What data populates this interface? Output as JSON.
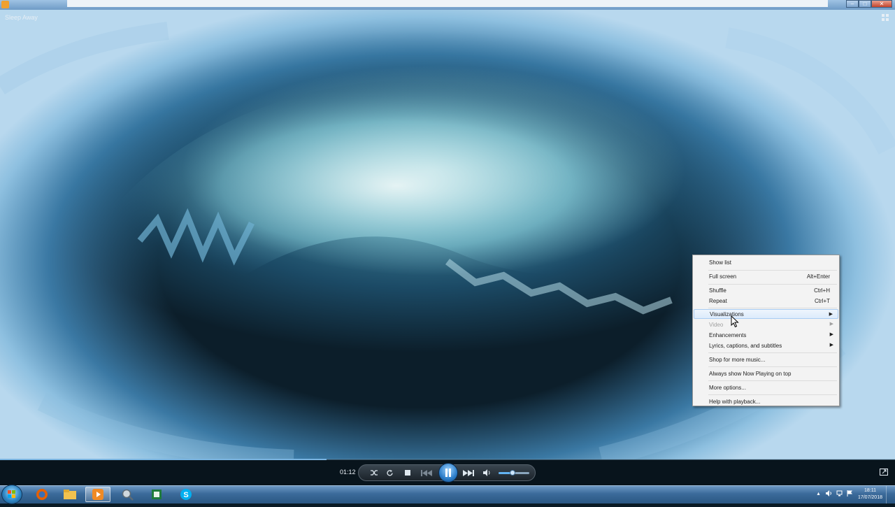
{
  "player": {
    "song_title": "Sleep Away",
    "elapsed": "01:12",
    "progress_fraction": 0.365,
    "volume_fraction": 0.45
  },
  "context_menu": {
    "items": [
      {
        "label": "Show list",
        "shortcut": "",
        "submenu": false,
        "disabled": false
      },
      {
        "label": "Full screen",
        "shortcut": "Alt+Enter",
        "submenu": false,
        "disabled": false
      },
      {
        "label": "Shuffle",
        "shortcut": "Ctrl+H",
        "submenu": false,
        "disabled": false
      },
      {
        "label": "Repeat",
        "shortcut": "Ctrl+T",
        "submenu": false,
        "disabled": false
      },
      {
        "label": "Visualizations",
        "shortcut": "",
        "submenu": true,
        "disabled": false,
        "highlighted": true
      },
      {
        "label": "Video",
        "shortcut": "",
        "submenu": true,
        "disabled": true
      },
      {
        "label": "Enhancements",
        "shortcut": "",
        "submenu": true,
        "disabled": false
      },
      {
        "label": "Lyrics, captions, and subtitles",
        "shortcut": "",
        "submenu": true,
        "disabled": false
      },
      {
        "label": "Shop for more music...",
        "shortcut": "",
        "submenu": false,
        "disabled": false
      },
      {
        "label": "Always show Now Playing on top",
        "shortcut": "",
        "submenu": false,
        "disabled": false
      },
      {
        "label": "More options...",
        "shortcut": "",
        "submenu": false,
        "disabled": false
      },
      {
        "label": "Help with playback...",
        "shortcut": "",
        "submenu": false,
        "disabled": false
      }
    ]
  },
  "taskbar": {
    "apps": [
      "firefox-icon",
      "file-explorer-icon",
      "windows-media-player-icon",
      "search-magnifier-icon",
      "spreadsheet-icon",
      "skype-icon"
    ],
    "active_app": "windows-media-player-icon",
    "clock_time": "18:11",
    "clock_date": "17/07/2018"
  },
  "colors": {
    "menu_bg": "#f3f3f3",
    "menu_highlight": "#dcebfc",
    "taskbar": "#3b6a9a",
    "play_button": "#2a7cc8"
  }
}
